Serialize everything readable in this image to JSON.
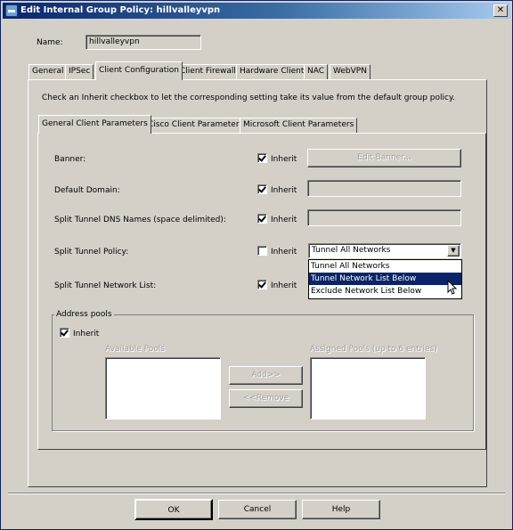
{
  "window": {
    "title": "Edit Internal Group Policy: hillvalleyvpn"
  },
  "name_field": {
    "label": "Name:",
    "value": "hillvalleyvpn"
  },
  "top_tabs": [
    {
      "label": "General"
    },
    {
      "label": "IPSec"
    },
    {
      "label": "Client Configuration"
    },
    {
      "label": "Client Firewall"
    },
    {
      "label": "Hardware Client"
    },
    {
      "label": "NAC"
    },
    {
      "label": "WebVPN"
    }
  ],
  "instruction": "Check an Inherit checkbox to let the corresponding setting take its value from the default group policy.",
  "sub_tabs": [
    {
      "label": "General Client Parameters"
    },
    {
      "label": "Cisco Client Parameters"
    },
    {
      "label": "Microsoft Client Parameters"
    }
  ],
  "rows": {
    "banner": {
      "label": "Banner:",
      "inherit_label": "Inherit",
      "inherit": true,
      "button": "Edit Banner..."
    },
    "default_domain": {
      "label": "Default Domain:",
      "inherit_label": "Inherit",
      "inherit": true
    },
    "split_dns": {
      "label": "Split Tunnel DNS Names (space delimited):",
      "inherit_label": "Inherit",
      "inherit": true
    },
    "split_policy": {
      "label": "Split Tunnel Policy:",
      "inherit_label": "Inherit",
      "inherit": false,
      "selected": "Tunnel All Networks"
    },
    "split_list": {
      "label": "Split Tunnel Network List:",
      "inherit_label": "Inherit",
      "inherit": true
    }
  },
  "dropdown_options": [
    {
      "label": "Tunnel All Networks"
    },
    {
      "label": "Tunnel Network List Below"
    },
    {
      "label": "Exclude Network List Below"
    }
  ],
  "address_pools": {
    "group_label": "Address pools",
    "inherit_label": "Inherit",
    "available_label": "Available Pools",
    "assigned_label": "Assigned Pools (up to 6 entries)",
    "add_label": "Add>>",
    "remove_label": "<<Remove"
  },
  "footer": {
    "ok": "OK",
    "cancel": "Cancel",
    "help": "Help"
  }
}
